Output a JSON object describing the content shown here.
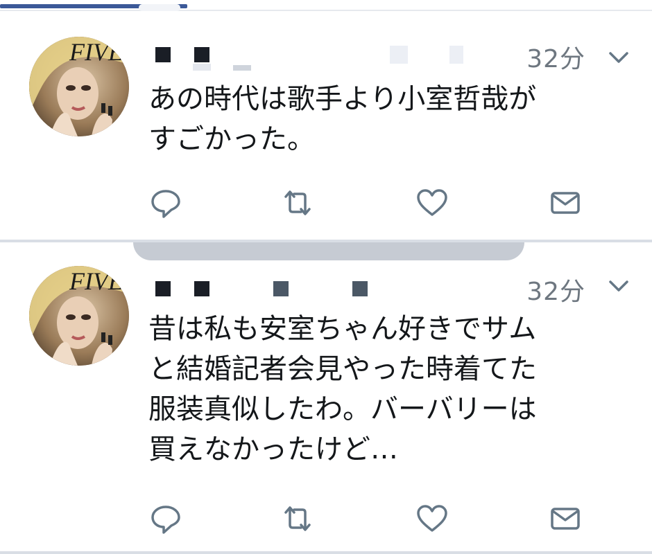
{
  "tweets": [
    {
      "time": "32分",
      "lines": [
        "あの時代は歌手より小室哲哉が",
        "すごかった。"
      ],
      "avatar_text": "FIVE"
    },
    {
      "time": "32分",
      "lines": [
        "昔は私も安室ちゃん好きでサム",
        "と結婚記者会見やった時着てた",
        "服装真似したわ。バーバリーは",
        "買えなかったけど…"
      ],
      "avatar_text": "FIVE"
    }
  ],
  "icons": {
    "reply": "reply-icon",
    "retweet": "retweet-icon",
    "like": "heart-icon",
    "dm": "mail-icon",
    "more": "chevron-down-icon"
  },
  "colors": {
    "icon": "#657786",
    "time": "#6e7780",
    "text": "#14171a",
    "background": "#ffffff"
  }
}
